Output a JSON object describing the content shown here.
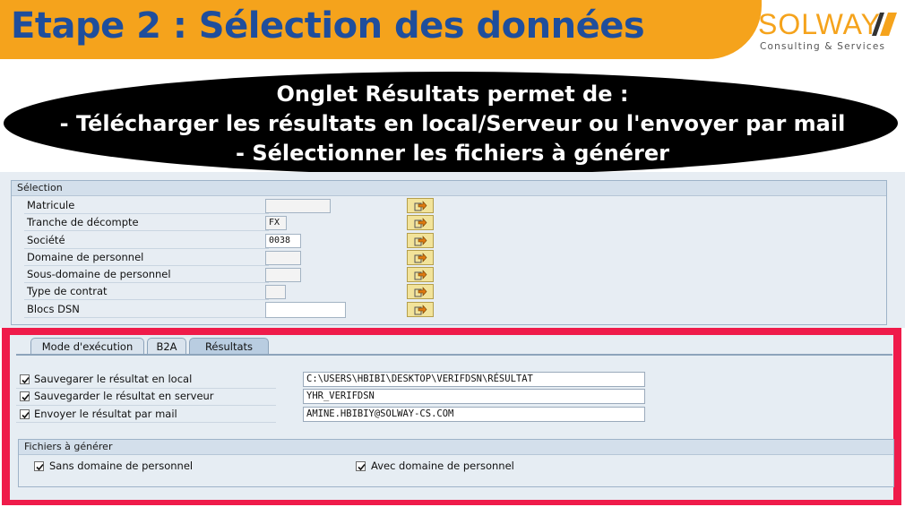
{
  "slide": {
    "title": "Etape 2 : Sélection des données",
    "logo_main": "SOLWAY",
    "logo_sub": "Consulting & Services",
    "callout_lines": [
      "Onglet Résultats permet de :",
      "- Télécharger les résultats en local/Serveur ou l'envoyer par mail",
      "- Sélectionner les fichiers à générer"
    ]
  },
  "selection": {
    "header": "Sélection",
    "rows": [
      {
        "label": "Matricule",
        "value": ""
      },
      {
        "label": "Tranche de décompte",
        "value": "FX"
      },
      {
        "label": "Société",
        "value": "0038"
      },
      {
        "label": "Domaine de personnel",
        "value": ""
      },
      {
        "label": "Sous-domaine de personnel",
        "value": ""
      },
      {
        "label": "Type de contrat",
        "value": ""
      },
      {
        "label": "Blocs DSN",
        "value": ""
      }
    ]
  },
  "tabs": [
    {
      "label": "Mode d'exécution",
      "active": false
    },
    {
      "label": "B2A",
      "active": false
    },
    {
      "label": "Résultats",
      "active": true
    }
  ],
  "results": {
    "options": [
      {
        "label": "Sauvegarer le résultat en local",
        "checked": true,
        "value": "C:\\USERS\\HBIBI\\DESKTOP\\VERIFDSN\\RÉSULTAT"
      },
      {
        "label": "Sauvegarder le résultat en serveur",
        "checked": true,
        "value": "YHR_VERIFDSN"
      },
      {
        "label": "Envoyer le résultat par mail",
        "checked": true,
        "value": "AMINE.HBIBIY@SOLWAY-CS.COM"
      }
    ],
    "files_header": "Fichiers à générer",
    "files": [
      {
        "label": "Sans domaine de personnel",
        "checked": true
      },
      {
        "label": "Avec domaine de personnel",
        "checked": true
      }
    ]
  },
  "colors": {
    "banner": "#f5a31c",
    "title": "#1f4e9c",
    "highlight": "#ef1b4a"
  }
}
